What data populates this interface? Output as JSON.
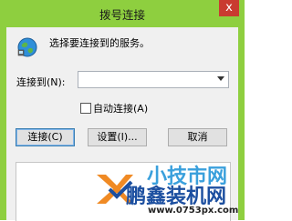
{
  "window": {
    "title": "拨号连接",
    "close_glyph": "x"
  },
  "dialog": {
    "prompt": "选择要连接到的服务。",
    "connect_to_label": "连接到(N):",
    "connect_to_value": "",
    "auto_connect_label": "自动连接(A)",
    "auto_connect_checked": false
  },
  "buttons": {
    "connect": "连接(C)",
    "settings": "设置(I)...",
    "cancel": "取消"
  },
  "watermark": {
    "top_text": "小技市网",
    "brand": "鹏鑫装机网",
    "url": "www.0753px.com"
  },
  "colors": {
    "frame": "#8ecf3f",
    "client": "#f0f0f0",
    "close": "#c93b30",
    "watermark_blue": "#1c4fa0",
    "watermark_orange": "#f08a24"
  },
  "icons": {
    "globe": "network-globe-icon"
  }
}
